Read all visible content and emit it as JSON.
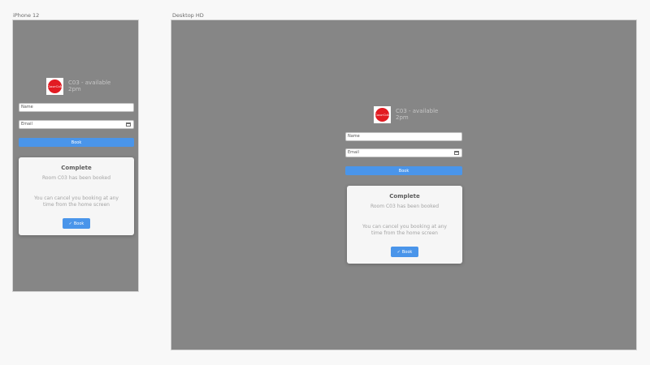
{
  "frames": {
    "mobile": {
      "label": "iPhone 12"
    },
    "desktop": {
      "label": "Desktop HD"
    }
  },
  "booking": {
    "logo_text": "Coca-Cola",
    "room_line1": "C03 - available",
    "room_line2": "2pm",
    "name_placeholder": "Name",
    "email_placeholder": "Email",
    "book_label": "Book"
  },
  "modal": {
    "title": "Complete",
    "subtitle": "Room C03 has been booked",
    "note": "You can cancel you booking at any time from the home screen",
    "done_label": "Book"
  },
  "icons": {
    "calendar": "calendar-icon",
    "check": "check-icon"
  },
  "colors": {
    "frame_background": "#868686",
    "primary_button": "#4a95ea",
    "logo_red": "#e21b22"
  }
}
